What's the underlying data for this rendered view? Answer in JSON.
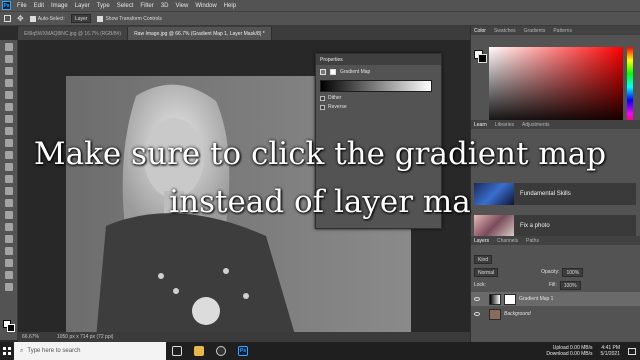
{
  "menubar": {
    "logo": "Ps",
    "items": [
      "File",
      "Edit",
      "Image",
      "Layer",
      "Type",
      "Select",
      "Filter",
      "3D",
      "View",
      "Window",
      "Help"
    ]
  },
  "options_bar": {
    "auto_select": "Auto-Select:",
    "auto_select_value": "Layer",
    "transform_controls": "Show Transform Controls"
  },
  "tabs": [
    {
      "label": "Ell9q5WXMAQ8lNC.jpg @ 16.7% (RGB/8#)",
      "active": false
    },
    {
      "label": "Raw Image.jpg @ 66.7% (Gradient Map 1, Layer Mask/8) *",
      "active": true
    }
  ],
  "properties": {
    "title": "Properties",
    "type": "Gradient Map",
    "dither": "Dither",
    "reverse": "Reverse"
  },
  "right_panels": {
    "color_tabs": [
      "Color",
      "Swatches",
      "Gradients",
      "Patterns"
    ],
    "learn_tabs": [
      "Learn",
      "Libraries",
      "Adjustments"
    ],
    "learn_cards": [
      "Fundamental Skills",
      "Fix a photo"
    ],
    "layers_tabs": [
      "Layers",
      "Channels",
      "Paths"
    ],
    "layers_kind": "Kind",
    "blend_mode": "Normal",
    "opacity_label": "Opacity:",
    "opacity_value": "100%",
    "lock_label": "Lock:",
    "fill_label": "Fill:",
    "fill_value": "100%",
    "layers": [
      {
        "name": "Gradient Map 1"
      },
      {
        "name": "Background"
      }
    ]
  },
  "status": {
    "zoom": "66.67%",
    "size": "1050 px x 714 px (72 ppi)"
  },
  "caption": {
    "line1": "Make sure to click the gradient map",
    "line2": "instead of layer ma"
  },
  "taskbar": {
    "search_placeholder": "Type here to search",
    "upload_label": "Upload",
    "upload_value": "0.00 MB/s",
    "download_label": "Download",
    "download_value": "0.00 MB/s",
    "time": "4:41 PM",
    "date": "5/1/2021"
  }
}
